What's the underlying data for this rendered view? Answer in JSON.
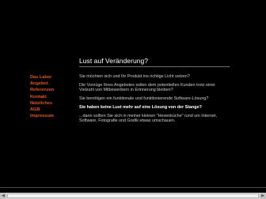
{
  "heading": "Lust auf Veränderung?",
  "nav": {
    "items": [
      {
        "label": "Das Labor"
      },
      {
        "label": "Angebot"
      },
      {
        "label": "Referenzen"
      },
      {
        "label": "Kontakt"
      },
      {
        "label": "Nützliches"
      },
      {
        "label": "AGB"
      },
      {
        "label": "Impressum"
      }
    ]
  },
  "content": {
    "paragraphs": [
      "Sie möchten sich und Ihr Produkt ins richtige Licht setzen?",
      "Die Vorzüge Ihres Angebotes sollen dem potentiellen Kunden trotz einer Vielzahl von Mitbewerbern in Erinnerung bleiben?",
      "Sie benötigen ein funktionale und funktionierende Software-Lösung?",
      "Sie haben keine Lust mehr auf eine Lösung von der Stange?",
      "...dann sollten Sie sich in meiner kleinen \"Hexenküche\" rund um Internet, Software, Fotografie und Grafik etwas umschauen."
    ]
  },
  "colors": {
    "background": "#000000",
    "nav_accent": "#e8541e",
    "heading": "#ffffff",
    "text": "#cfcfcf"
  }
}
